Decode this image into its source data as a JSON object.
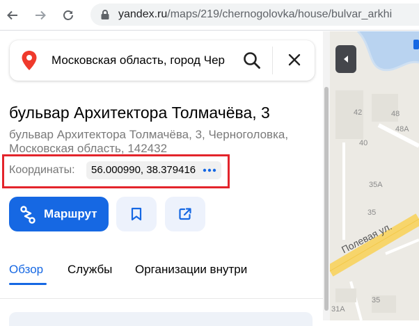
{
  "browser": {
    "url_domain": "yandex.ru",
    "url_path": "/maps/219/chernogolovka/house/bulvar_arkhi"
  },
  "search": {
    "value": "Московская область, город Чер"
  },
  "place": {
    "title": "бульвар Архитектора Толмачёва, 3",
    "address": "бульвар Архитектора Толмачёва, 3, Черноголовка, Московская область, 142432",
    "coords_label": "Координаты:",
    "coords_value": "56.000990, 38.379416"
  },
  "actions": {
    "route_label": "Маршрут"
  },
  "tabs": [
    {
      "label": "Обзор",
      "active": true
    },
    {
      "label": "Службы",
      "active": false
    },
    {
      "label": "Организации внутри",
      "active": false
    }
  ],
  "map": {
    "house_numbers": [
      "42",
      "48",
      "48А",
      "40",
      "35А",
      "35",
      "35",
      "31А"
    ],
    "street": "Полевая ул."
  },
  "colors": {
    "accent": "#1668e3",
    "highlight_frame": "#e3242b",
    "pin": "#ef3a2c",
    "road": "#f7d56b"
  }
}
